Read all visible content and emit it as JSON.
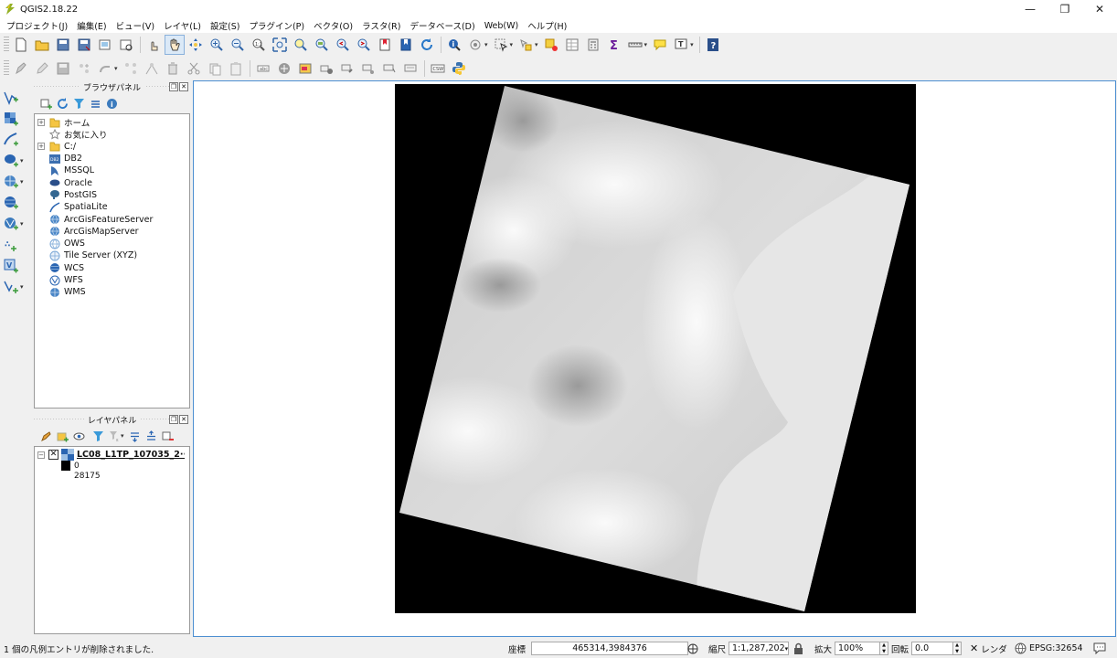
{
  "window": {
    "title": "QGIS2.18.22",
    "logo_icon": "qgis-logo-icon",
    "controls": [
      "minimize-icon",
      "restore-icon",
      "close-icon"
    ]
  },
  "menubar": {
    "items": [
      "プロジェクト(J)",
      "編集(E)",
      "ビュー(V)",
      "レイヤ(L)",
      "設定(S)",
      "プラグイン(P)",
      "ベクタ(O)",
      "ラスタ(R)",
      "データベース(D)",
      "Web(W)",
      "ヘルプ(H)"
    ]
  },
  "toolbar_icons": {
    "row1": [
      "new-project-icon",
      "open-project-icon",
      "save-project-icon",
      "save-as-icon",
      "new-print-composer-icon",
      "composer-manager-icon",
      "touch-icon",
      "pan-icon",
      "pan-to-selection-icon",
      "zoom-in-icon",
      "zoom-out-icon",
      "zoom-native-icon",
      "zoom-full-icon",
      "zoom-to-selection-icon",
      "zoom-to-layer-icon",
      "zoom-last-icon",
      "zoom-next-icon",
      "new-bookmark-icon",
      "show-bookmarks-icon",
      "refresh-icon",
      "identify-icon",
      "action-icon",
      "select-icon",
      "deselect-icon",
      "open-attribute-table-icon",
      "field-calculator-icon",
      "statistics-icon",
      "measure-icon",
      "map-tips-icon",
      "text-annotation-icon",
      "whats-this-icon"
    ],
    "row2": [
      "edits-icon",
      "toggle-editing-icon",
      "save-edits-icon",
      "add-feature-icon",
      "move-feature-icon",
      "node-tool-icon",
      "delete-selected-icon",
      "cut-features-icon",
      "copy-features-icon",
      "paste-features-icon",
      "label-icon",
      "pin-labels-icon",
      "show-labels-icon",
      "move-label-icon",
      "rotate-label-icon",
      "change-label-icon",
      "csw-icon",
      "python-icon"
    ]
  },
  "left_toolbar_icons": [
    "add-vector-layer-icon",
    "add-raster-layer-icon",
    "add-spatialite-layer-icon",
    "add-postgis-layer-icon",
    "add-wms-layer-icon",
    "add-wcs-layer-icon",
    "add-wfs-layer-icon",
    "add-delimited-text-icon",
    "add-virtual-layer-icon",
    "new-shapefile-icon"
  ],
  "browser_panel": {
    "title": "ブラウザパネル",
    "tool_icons": [
      "add-selected-layers-icon",
      "refresh-icon",
      "filter-icon",
      "collapse-all-icon",
      "properties-icon"
    ],
    "items": [
      {
        "label": "ホーム",
        "icon": "folder-icon",
        "expandable": true
      },
      {
        "label": "お気に入り",
        "icon": "star-icon",
        "expandable": false
      },
      {
        "label": "C:/",
        "icon": "folder-icon",
        "expandable": true
      },
      {
        "label": "DB2",
        "icon": "db2-icon",
        "expandable": false
      },
      {
        "label": "MSSQL",
        "icon": "mssql-icon",
        "expandable": false
      },
      {
        "label": "Oracle",
        "icon": "oracle-icon",
        "expandable": false
      },
      {
        "label": "PostGIS",
        "icon": "postgis-icon",
        "expandable": false
      },
      {
        "label": "SpatiaLite",
        "icon": "spatialite-icon",
        "expandable": false
      },
      {
        "label": "ArcGisFeatureServer",
        "icon": "arcgis-globe-icon",
        "expandable": false
      },
      {
        "label": "ArcGisMapServer",
        "icon": "arcgis-globe-icon",
        "expandable": false
      },
      {
        "label": "OWS",
        "icon": "ows-globe-icon",
        "expandable": false
      },
      {
        "label": "Tile Server (XYZ)",
        "icon": "xyz-globe-icon",
        "expandable": false
      },
      {
        "label": "WCS",
        "icon": "wcs-icon",
        "expandable": false
      },
      {
        "label": "WFS",
        "icon": "wfs-icon",
        "expandable": false
      },
      {
        "label": "WMS",
        "icon": "wms-icon",
        "expandable": false
      }
    ]
  },
  "layers_panel": {
    "title": "レイヤパネル",
    "tool_icons": [
      "style-icon",
      "add-group-icon",
      "manage-visibility-icon",
      "filter-legend-icon",
      "filter-expression-icon",
      "expand-all-icon",
      "collapse-all-icon",
      "remove-layer-icon"
    ],
    "layer": {
      "name": "LC08_L1TP_107035_2···",
      "visible": true,
      "icon": "raster-layer-icon",
      "legend_min": "0",
      "legend_max": "28175"
    }
  },
  "status_bar": {
    "message": "1 個の凡例エントリが削除されました.",
    "coordinate_label": "座標",
    "coordinate_value": "465314,3984376",
    "scale_label": "縮尺",
    "scale_value": "1:1,287,202",
    "magnifier_label": "拡大",
    "magnifier_value": "100%",
    "rotation_label": "回転",
    "rotation_value": "0.0",
    "render_label": "レンダ",
    "render_checked": true,
    "crs_value": "EPSG:32654",
    "lock_icon": "lock-icon",
    "messages_icon": "messages-icon"
  }
}
